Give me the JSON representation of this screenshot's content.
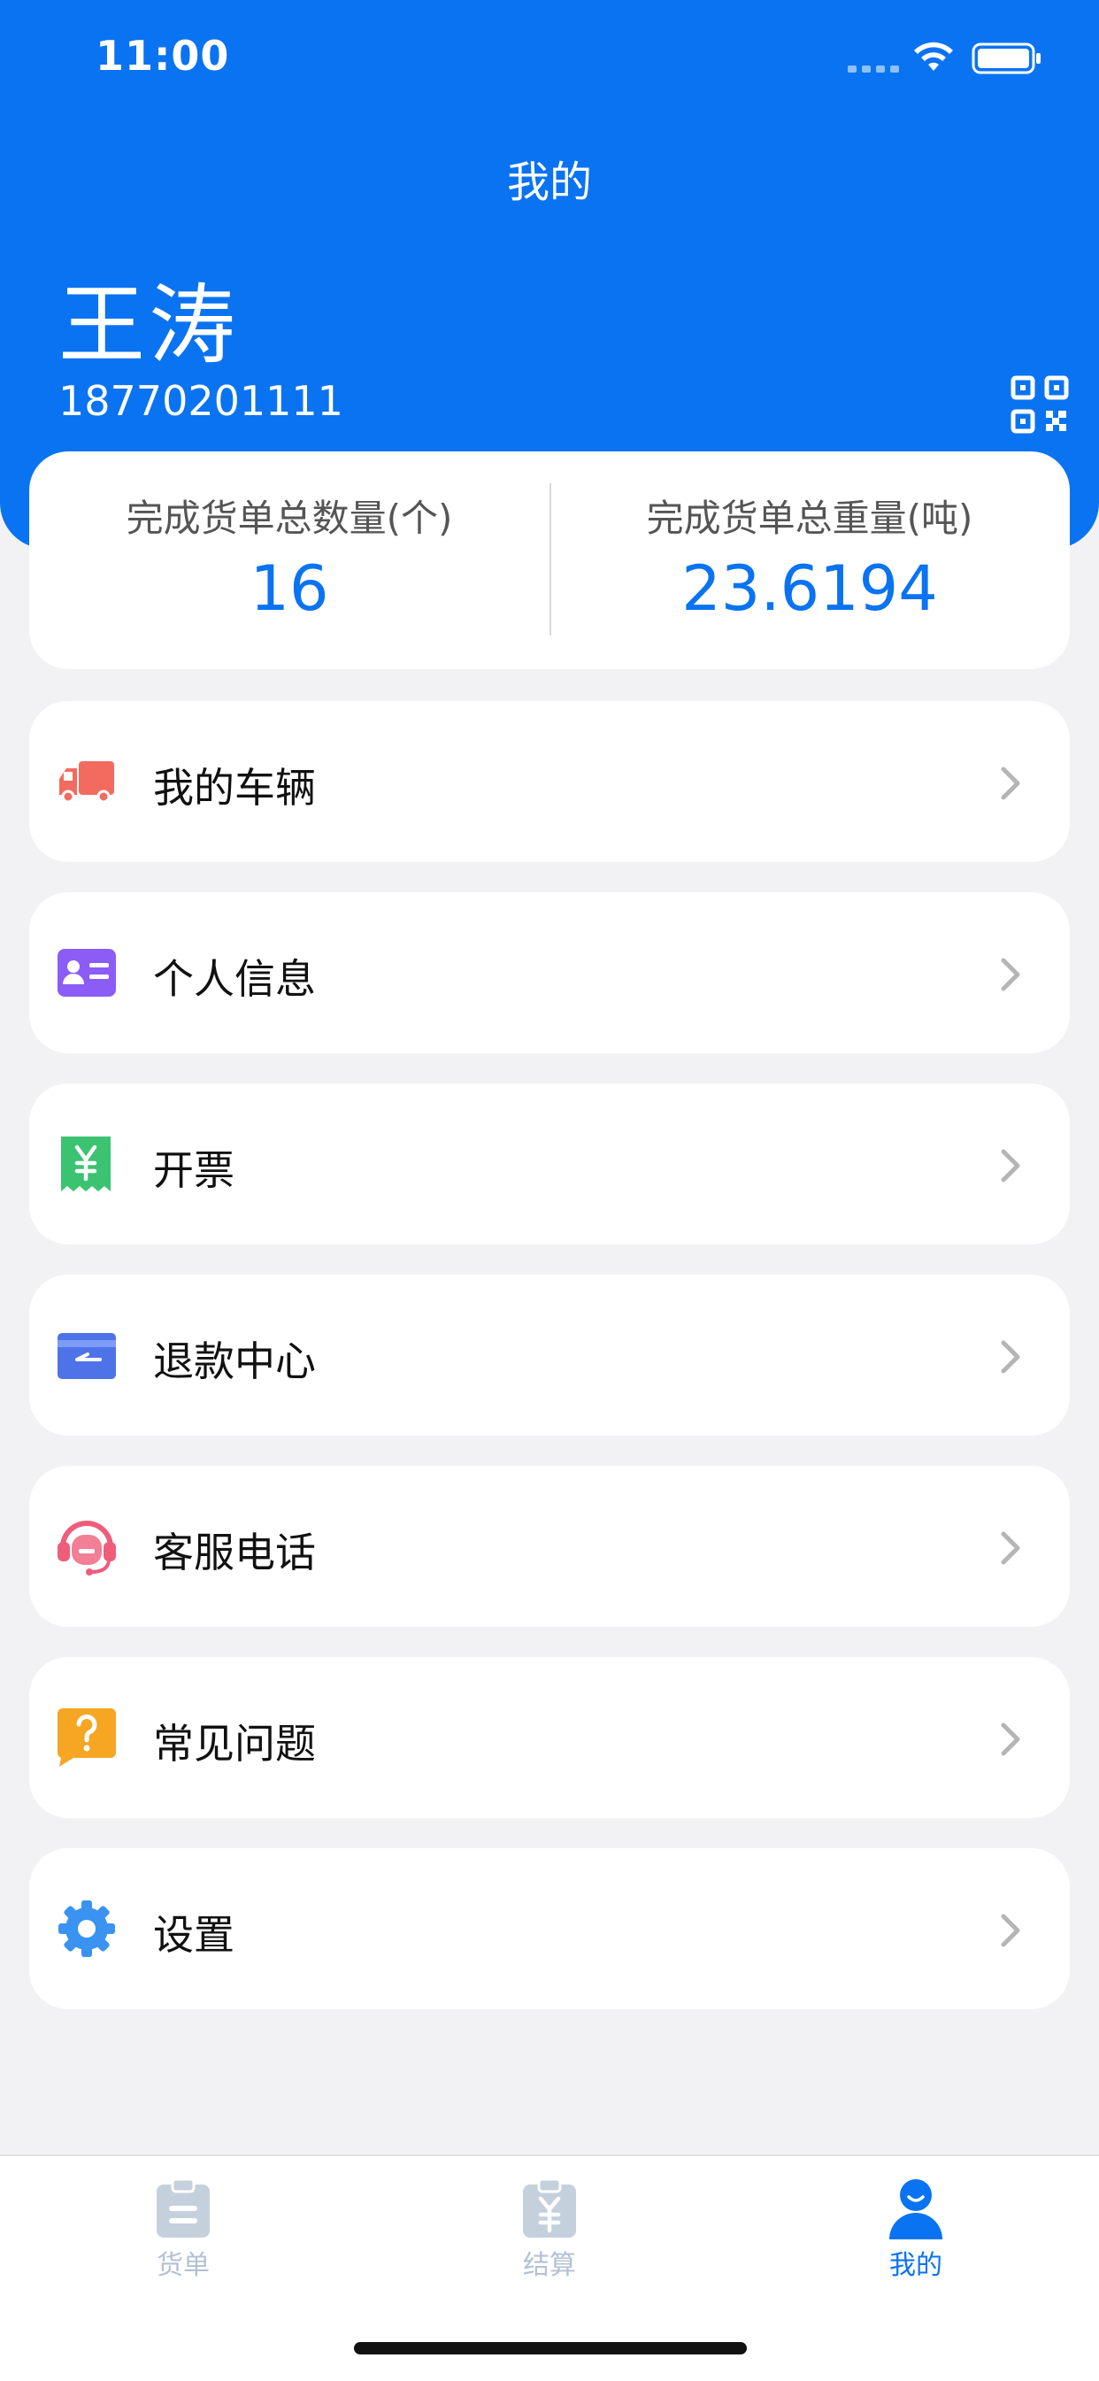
{
  "status_bar": {
    "time": "11:00"
  },
  "nav": {
    "title": "我的"
  },
  "user": {
    "name": "王涛",
    "phone": "18770201111"
  },
  "stats": {
    "count_label": "完成货单总数量(个)",
    "count_value": "16",
    "weight_label": "完成货单总重量(吨)",
    "weight_value": "23.6194"
  },
  "menu": [
    {
      "label": "我的车辆",
      "icon": "truck-icon"
    },
    {
      "label": "个人信息",
      "icon": "id-card-icon"
    },
    {
      "label": "开票",
      "icon": "invoice-icon"
    },
    {
      "label": "退款中心",
      "icon": "refund-icon"
    },
    {
      "label": "客服电话",
      "icon": "headset-icon"
    },
    {
      "label": "常见问题",
      "icon": "question-icon"
    },
    {
      "label": "设置",
      "icon": "gear-icon"
    }
  ],
  "tabs": [
    {
      "label": "货单",
      "icon": "waybill-icon",
      "active": false
    },
    {
      "label": "结算",
      "icon": "settlement-icon",
      "active": false
    },
    {
      "label": "我的",
      "icon": "user-icon",
      "active": true
    }
  ],
  "colors": {
    "primary": "#0A73F2",
    "background": "#F2F2F4",
    "tab_inactive": "#B3C1D4"
  }
}
